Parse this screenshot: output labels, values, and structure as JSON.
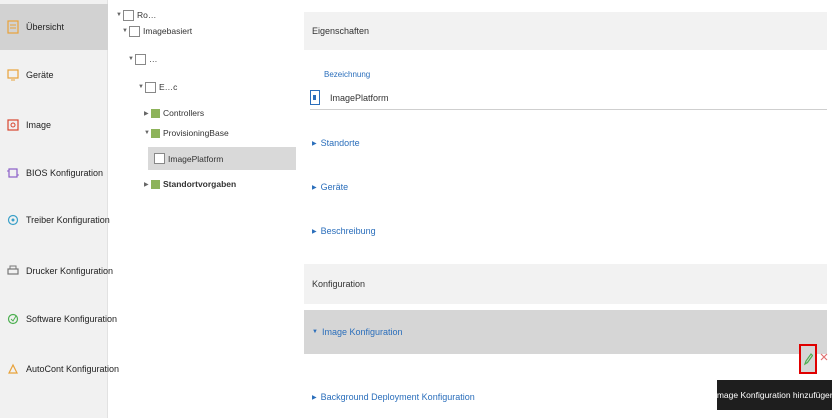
{
  "sidebar": {
    "items": [
      {
        "label": "Übersicht",
        "icon": "overview-icon"
      },
      {
        "label": "Geräte",
        "icon": "devices-icon"
      },
      {
        "label": "Image",
        "icon": "image-icon"
      },
      {
        "label": "BIOS Konfiguration",
        "icon": "bios-config-icon"
      },
      {
        "label": "Treiber Konfiguration",
        "icon": "driver-config-icon"
      },
      {
        "label": "Drucker Konfiguration",
        "icon": "printer-config-icon"
      },
      {
        "label": "Software Konfiguration",
        "icon": "software-config-icon"
      },
      {
        "label": "AutoCont Konfiguration",
        "icon": "autocont-config-icon"
      }
    ]
  },
  "tree": {
    "nodes": [
      {
        "label": "Ro…",
        "level": 0
      },
      {
        "label": "Imagebasiert",
        "level": 1
      },
      {
        "label": "…",
        "level": 2
      },
      {
        "label": "E…c",
        "level": 3
      },
      {
        "label": "Controllers",
        "level": 4
      },
      {
        "label": "ProvisioningBase",
        "level": 4
      },
      {
        "label": "ImagePlatform",
        "level": 5,
        "selected": true
      },
      {
        "label": "Standortvorgaben",
        "level": 4
      }
    ]
  },
  "main": {
    "section1_title": "Eigenschaften",
    "field_label": "Bezeichnung",
    "field_value": "ImagePlatform",
    "links": [
      "Standorte",
      "Geräte",
      "Beschreibung"
    ],
    "section2_title": "Konfiguration",
    "image_config_label": "Image Konfiguration",
    "bg_deploy_label": "Background Deployment Konfiguration"
  },
  "tooltip": {
    "text": "Image Konfiguration hinzufügen"
  },
  "colors": {
    "accent": "#2a6ebb",
    "highlight_border": "#e00000",
    "sidebar_active": "#d2d2d2"
  }
}
